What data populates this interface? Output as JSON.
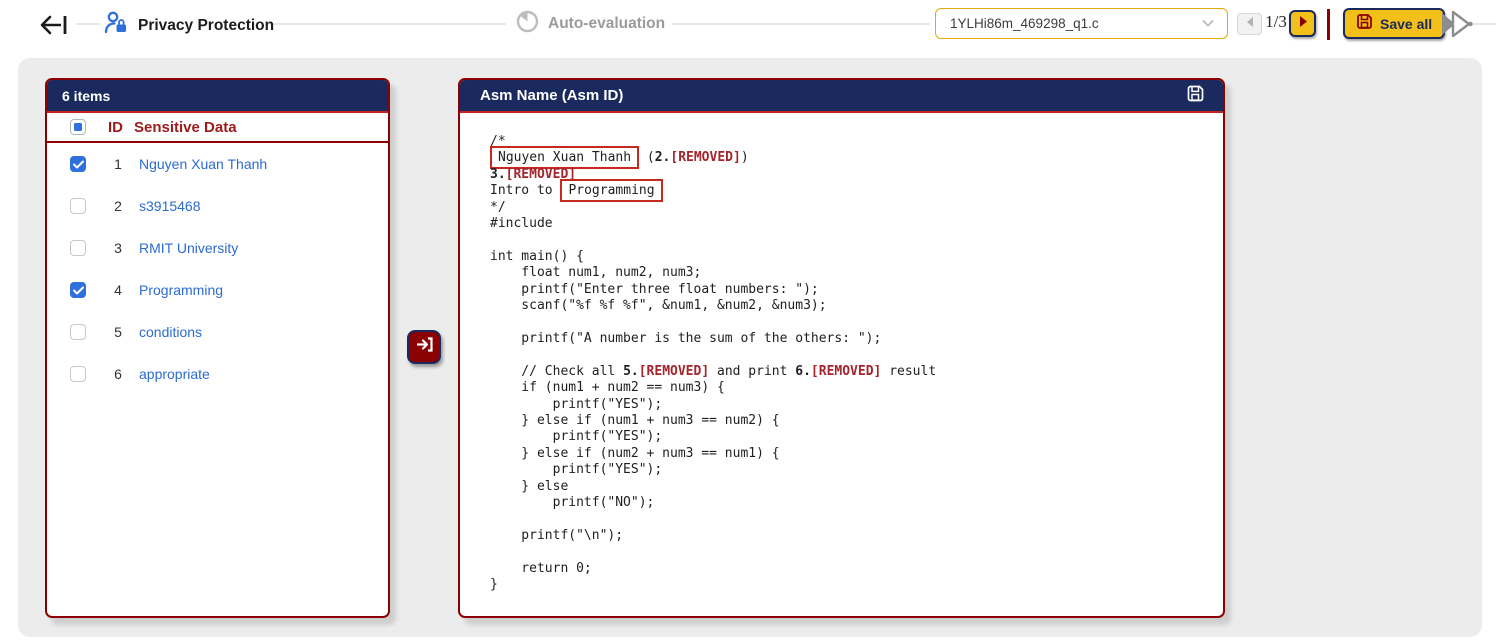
{
  "header": {
    "steps": [
      {
        "label": "Privacy Protection",
        "icon": "user-lock-icon",
        "state": "active"
      },
      {
        "label": "Auto-evaluation",
        "icon": "gauge-icon",
        "state": "inactive"
      }
    ],
    "file_select": {
      "value": "1YLHi86m_469298_q1.c"
    },
    "pagination": {
      "current": "1/3"
    },
    "save_all_label": "Save all"
  },
  "left_panel": {
    "title": "6 items",
    "columns": {
      "id": "ID",
      "data": "Sensitive Data"
    },
    "rows": [
      {
        "id": "1",
        "text": "Nguyen Xuan Thanh",
        "checked": true
      },
      {
        "id": "2",
        "text": "s3915468",
        "checked": false
      },
      {
        "id": "3",
        "text": "RMIT University",
        "checked": false
      },
      {
        "id": "4",
        "text": "Programming",
        "checked": true
      },
      {
        "id": "5",
        "text": "conditions",
        "checked": false
      },
      {
        "id": "6",
        "text": "appropriate",
        "checked": false
      }
    ]
  },
  "right_panel": {
    "title": "Asm Name (Asm ID)",
    "code_lines": [
      [
        {
          "t": "/*",
          "s": "p"
        }
      ],
      [
        {
          "t": "Nguyen Xuan Thanh",
          "s": "x"
        },
        {
          "t": " (",
          "s": "p"
        },
        {
          "t": "2.",
          "s": "b"
        },
        {
          "t": "[REMOVED]",
          "s": "r"
        },
        {
          "t": ")",
          "s": "p"
        }
      ],
      [
        {
          "t": "3.",
          "s": "b"
        },
        {
          "t": "[REMOVED]",
          "s": "r"
        }
      ],
      [
        {
          "t": "Intro to ",
          "s": "p"
        },
        {
          "t": "Programming",
          "s": "x"
        }
      ],
      [
        {
          "t": "*/",
          "s": "p"
        }
      ],
      [
        {
          "t": "#include",
          "s": "p"
        }
      ],
      [],
      [
        {
          "t": "int main() {",
          "s": "p"
        }
      ],
      [
        {
          "t": "    float num1, num2, num3;",
          "s": "p"
        }
      ],
      [
        {
          "t": "    printf(\"Enter three float numbers: \");",
          "s": "p"
        }
      ],
      [
        {
          "t": "    scanf(\"%f %f %f\", &num1, &num2, &num3);",
          "s": "p"
        }
      ],
      [],
      [
        {
          "t": "    printf(\"A number is the sum of the others: \");",
          "s": "p"
        }
      ],
      [],
      [
        {
          "t": "    // Check all ",
          "s": "p"
        },
        {
          "t": "5.",
          "s": "b"
        },
        {
          "t": "[REMOVED]",
          "s": "r"
        },
        {
          "t": " and print ",
          "s": "p"
        },
        {
          "t": "6.",
          "s": "b"
        },
        {
          "t": "[REMOVED]",
          "s": "r"
        },
        {
          "t": " result",
          "s": "p"
        }
      ],
      [
        {
          "t": "    if (num1 + num2 == num3) {",
          "s": "p"
        }
      ],
      [
        {
          "t": "        printf(\"YES\");",
          "s": "p"
        }
      ],
      [
        {
          "t": "    } else if (num1 + num3 == num2) {",
          "s": "p"
        }
      ],
      [
        {
          "t": "        printf(\"YES\");",
          "s": "p"
        }
      ],
      [
        {
          "t": "    } else if (num2 + num3 == num1) {",
          "s": "p"
        }
      ],
      [
        {
          "t": "        printf(\"YES\");",
          "s": "p"
        }
      ],
      [
        {
          "t": "    } else",
          "s": "p"
        }
      ],
      [
        {
          "t": "        printf(\"NO\");",
          "s": "p"
        }
      ],
      [],
      [
        {
          "t": "    printf(\"\\n\");",
          "s": "p"
        }
      ],
      [],
      [
        {
          "t": "    return 0;",
          "s": "p"
        }
      ],
      [
        {
          "t": "}",
          "s": "p"
        }
      ]
    ]
  },
  "colors": {
    "navy": "#1b2a5e",
    "maroon_border": "#8b0000",
    "heading_red": "#9e1b1b",
    "removed_text_red": "#a4262c",
    "highlight_box_red": "#c42b1c",
    "accent_yellow": "#f2c018",
    "dropdown_gold": "#e3a90b",
    "link_blue": "#2b6bd3",
    "checkbox_blue": "#2f6fde"
  }
}
